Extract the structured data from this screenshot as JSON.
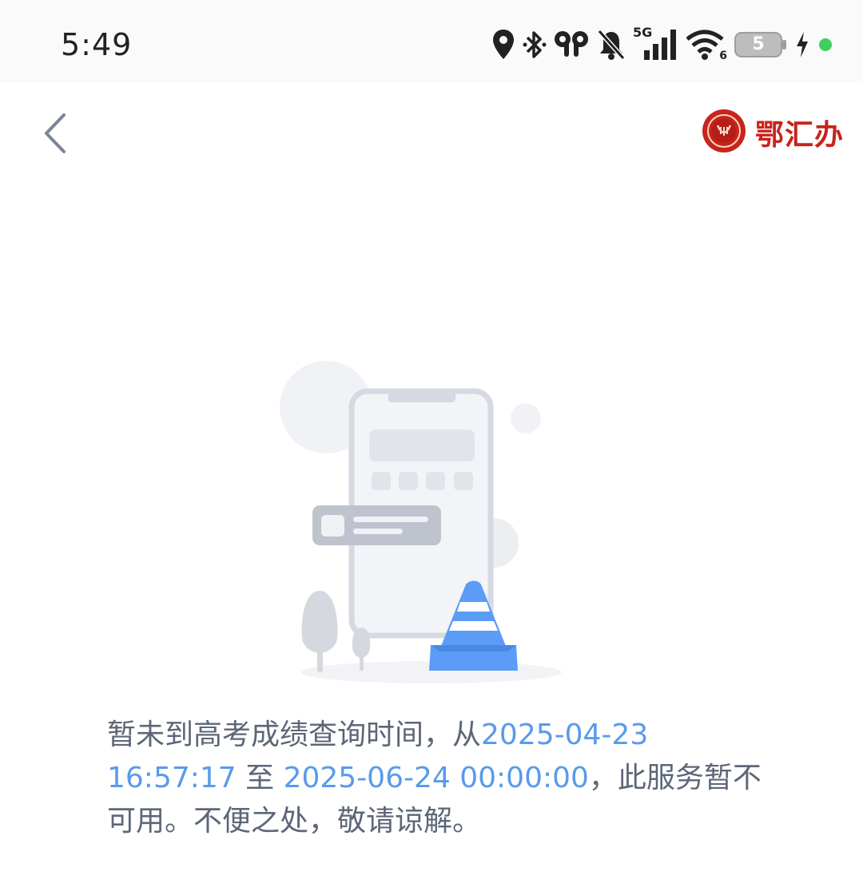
{
  "status_bar": {
    "time": "5:49",
    "network": "5G",
    "wifi_level": "6",
    "battery_level": "5",
    "icons": [
      "location-icon",
      "bluetooth-icon",
      "earbuds-icon",
      "bell-muted-icon",
      "signal-5g-icon",
      "wifi-icon",
      "battery-icon",
      "charging-icon",
      "status-dot-icon"
    ]
  },
  "header": {
    "back_icon": "chevron-left-icon",
    "brand_name": "鄂汇办",
    "brand_logo_icon": "emblem-icon"
  },
  "message": {
    "part1": "暂未到高考成绩查询时间，从",
    "start_time": "2025-04-23 16:57:17",
    "part2": " 至 ",
    "end_time": "2025-06-24 00:00:00",
    "part3": "，此服务暂不可用。不便之处，敬请谅解。"
  },
  "colors": {
    "brand_red": "#c8231c",
    "highlight_blue": "#5a9aeb",
    "text_gray": "#5d6677",
    "cone_blue": "#5b9cf6"
  }
}
